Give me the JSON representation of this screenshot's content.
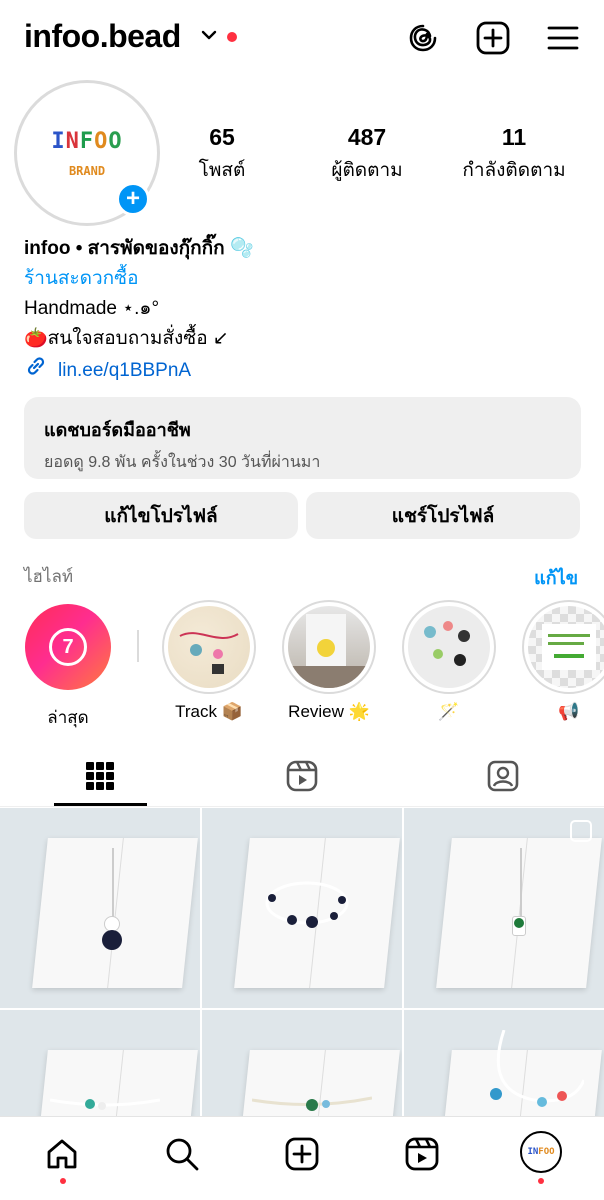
{
  "header": {
    "username": "infoo.bead",
    "icons": [
      "threads-icon",
      "create-icon",
      "menu-icon"
    ]
  },
  "avatar": {
    "logo_main": "INFOO",
    "logo_sub": "BRAND"
  },
  "stats": [
    {
      "value": "65",
      "label": "โพสต์"
    },
    {
      "value": "487",
      "label": "ผู้ติดตาม"
    },
    {
      "value": "11",
      "label": "กำลังติดตาม"
    }
  ],
  "bio": {
    "name": "infoo • สารพัดของกุ๊กกิ๊ก 🫧",
    "category": "ร้านสะดวกซื้อ",
    "line1": "Handmade ⋆.๑°",
    "line2": "🍅สนใจสอบถามสั่งซื้อ ↙",
    "link": "lin.ee/q1BBPnA"
  },
  "dashboard": {
    "title": "แดชบอร์ดมืออาชีพ",
    "subtitle": "ยอดดู 9.8 พัน ครั้งในช่วง 30 วันที่ผ่านมา"
  },
  "buttons": {
    "edit": "แก้ไขโปรไฟล์",
    "share": "แชร์โปรไฟล์"
  },
  "highlights": {
    "title": "ไฮไลท์",
    "edit": "แก้ไข",
    "latest": {
      "label": "ล่าสุด",
      "badge": "7"
    },
    "items": [
      {
        "label": "Track 📦"
      },
      {
        "label": "Review 🌟"
      },
      {
        "label": "🪄"
      },
      {
        "label": "📢"
      }
    ]
  },
  "tabs": [
    "grid-icon",
    "reels-icon",
    "tagged-icon"
  ],
  "bottom_nav": [
    "home-icon",
    "search-icon",
    "create-icon",
    "reels-icon",
    "profile-avatar"
  ],
  "colors": {
    "accent": "#0095f6",
    "notify": "#ff3040"
  }
}
